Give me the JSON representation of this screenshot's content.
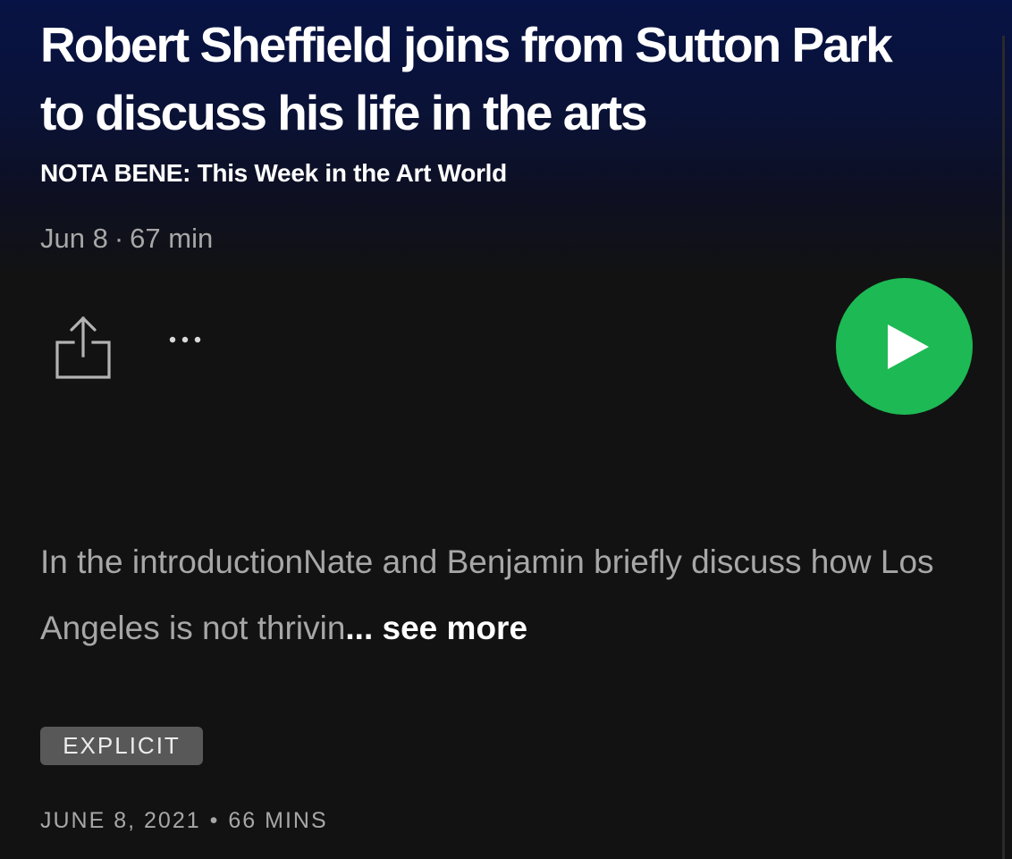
{
  "episode": {
    "title": "Robert Sheffield joins from Sutton Park to discuss his life in the arts",
    "show_name": "NOTA BENE: This Week in the Art World",
    "date_short": "Jun 8",
    "separator": "·",
    "duration_short": "67 min"
  },
  "actions": {
    "share_icon": "share-icon",
    "more_icon": "more-options-icon",
    "play_icon": "play-icon",
    "play_color": "#1db954"
  },
  "description": {
    "text": "In the introductionNate and Benjamin briefly discuss how Los Angeles is not thrivin",
    "ellipsis": "...",
    "see_more": "see more"
  },
  "badge": {
    "label": "EXPLICIT"
  },
  "release": {
    "date": "JUNE 8, 2021",
    "bullet": "•",
    "duration": "66 MINS"
  }
}
